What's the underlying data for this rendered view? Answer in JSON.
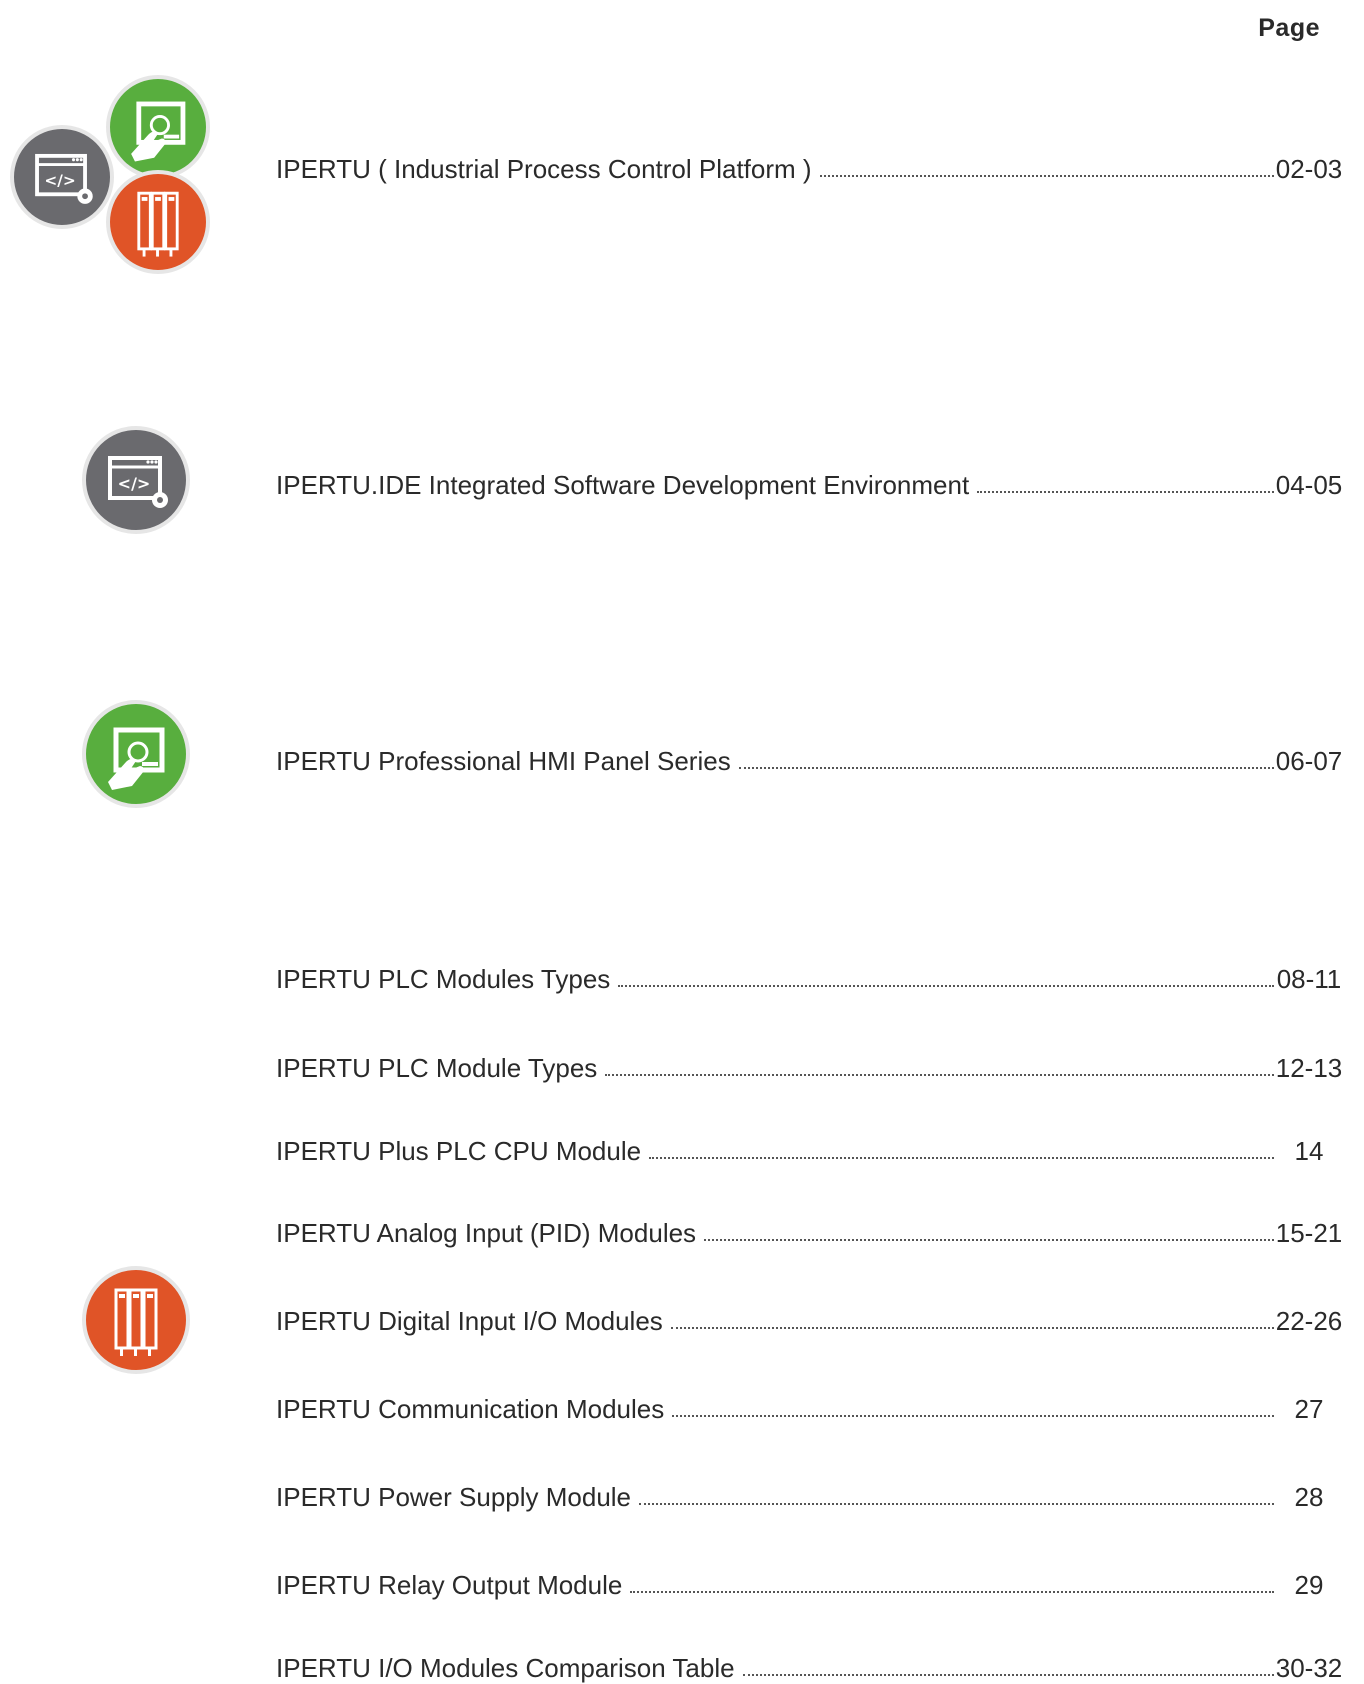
{
  "header": {
    "page_label": "Page"
  },
  "icons": {
    "hmi": "hmi-touch-panel-icon",
    "ide": "code-window-gear-icon",
    "plc": "plc-module-rack-icon",
    "colors": {
      "green": "#58ae3e",
      "gray": "#6a6a6e",
      "orange": "#e05427"
    }
  },
  "toc": [
    {
      "title": "IPERTU ( Industrial Process Control Platform )",
      "page": "02-03"
    },
    {
      "title": "IPERTU.IDE Integrated Software Development Environment",
      "page": "04-05"
    },
    {
      "title": "IPERTU Professional HMI Panel Series",
      "page": "06-07"
    },
    {
      "title": "IPERTU PLC Modules Types",
      "page": "08-11"
    },
    {
      "title": "IPERTU PLC Module Types",
      "page": "12-13"
    },
    {
      "title": "IPERTU Plus PLC CPU Module",
      "page": "14"
    },
    {
      "title": "IPERTU Analog Input (PID) Modules",
      "page": "15-21"
    },
    {
      "title": "IPERTU Digital Input I/O Modules",
      "page": "22-26"
    },
    {
      "title": "IPERTU Communication Modules",
      "page": "27"
    },
    {
      "title": "IPERTU Power Supply Module",
      "page": "28"
    },
    {
      "title": "IPERTU Relay Output Module",
      "page": "29"
    },
    {
      "title": "IPERTU I/O Modules Comparison Table",
      "page": "30-32"
    }
  ]
}
